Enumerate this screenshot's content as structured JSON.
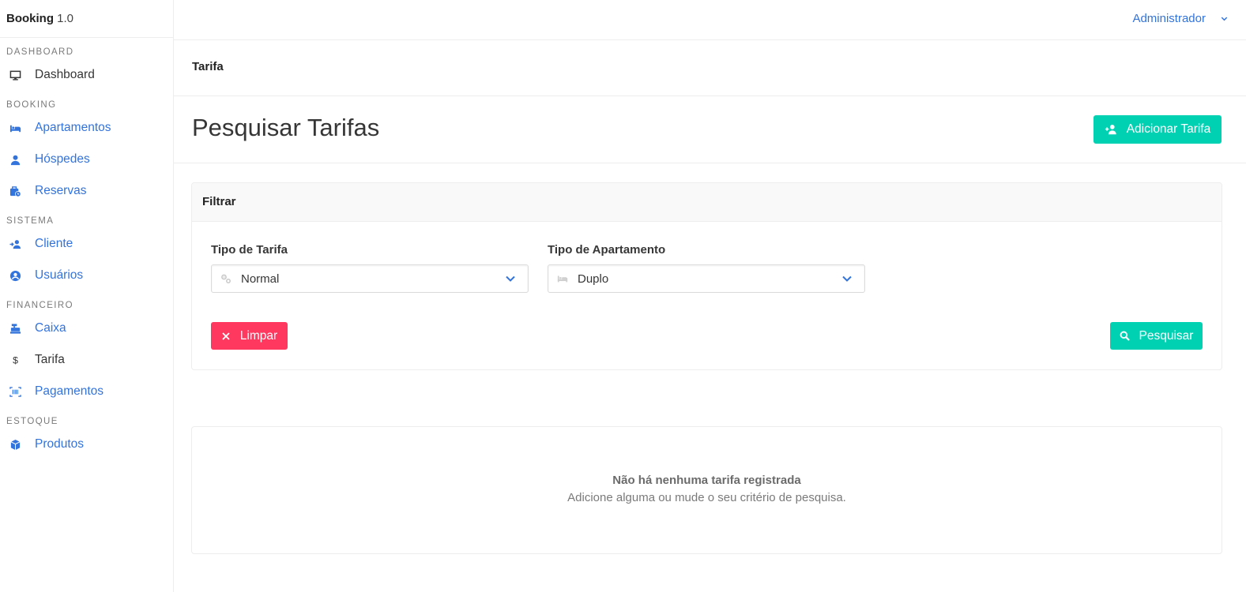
{
  "app": {
    "name": "Booking",
    "version": "1.0"
  },
  "user": {
    "label": "Administrador"
  },
  "sidebar": {
    "sections": [
      {
        "label": "DASHBOARD",
        "items": [
          {
            "label": "Dashboard",
            "icon": "monitor-icon"
          }
        ]
      },
      {
        "label": "BOOKING",
        "items": [
          {
            "label": "Apartamentos",
            "icon": "bed-icon"
          },
          {
            "label": "Hóspedes",
            "icon": "user-icon"
          },
          {
            "label": "Reservas",
            "icon": "briefcase-clock-icon"
          }
        ]
      },
      {
        "label": "SISTEMA",
        "items": [
          {
            "label": "Cliente",
            "icon": "user-arrow-icon"
          },
          {
            "label": "Usuários",
            "icon": "user-circle-icon"
          }
        ]
      },
      {
        "label": "FINANCEIRO",
        "items": [
          {
            "label": "Caixa",
            "icon": "cash-register-icon"
          },
          {
            "label": "Tarifa",
            "icon": "dollar-icon"
          },
          {
            "label": "Pagamentos",
            "icon": "barcode-icon"
          }
        ]
      },
      {
        "label": "ESTOQUE",
        "items": [
          {
            "label": "Produtos",
            "icon": "box-icon"
          }
        ]
      }
    ]
  },
  "breadcrumb": {
    "current": "Tarifa"
  },
  "page": {
    "title": "Pesquisar Tarifas",
    "add_button": "Adicionar Tarifa"
  },
  "filter": {
    "title": "Filtrar",
    "rate_type": {
      "label": "Tipo de Tarifa",
      "value": "Normal"
    },
    "apartment_type": {
      "label": "Tipo de Apartamento",
      "value": "Duplo"
    },
    "clear_button": "Limpar",
    "search_button": "Pesquisar"
  },
  "empty_state": {
    "title": "Não há nenhuma tarifa registrada",
    "subtitle": "Adicione alguma ou mude o seu critério de pesquisa."
  },
  "colors": {
    "primary": "#3273dc",
    "success": "#00d1b2",
    "danger": "#ff3860"
  }
}
